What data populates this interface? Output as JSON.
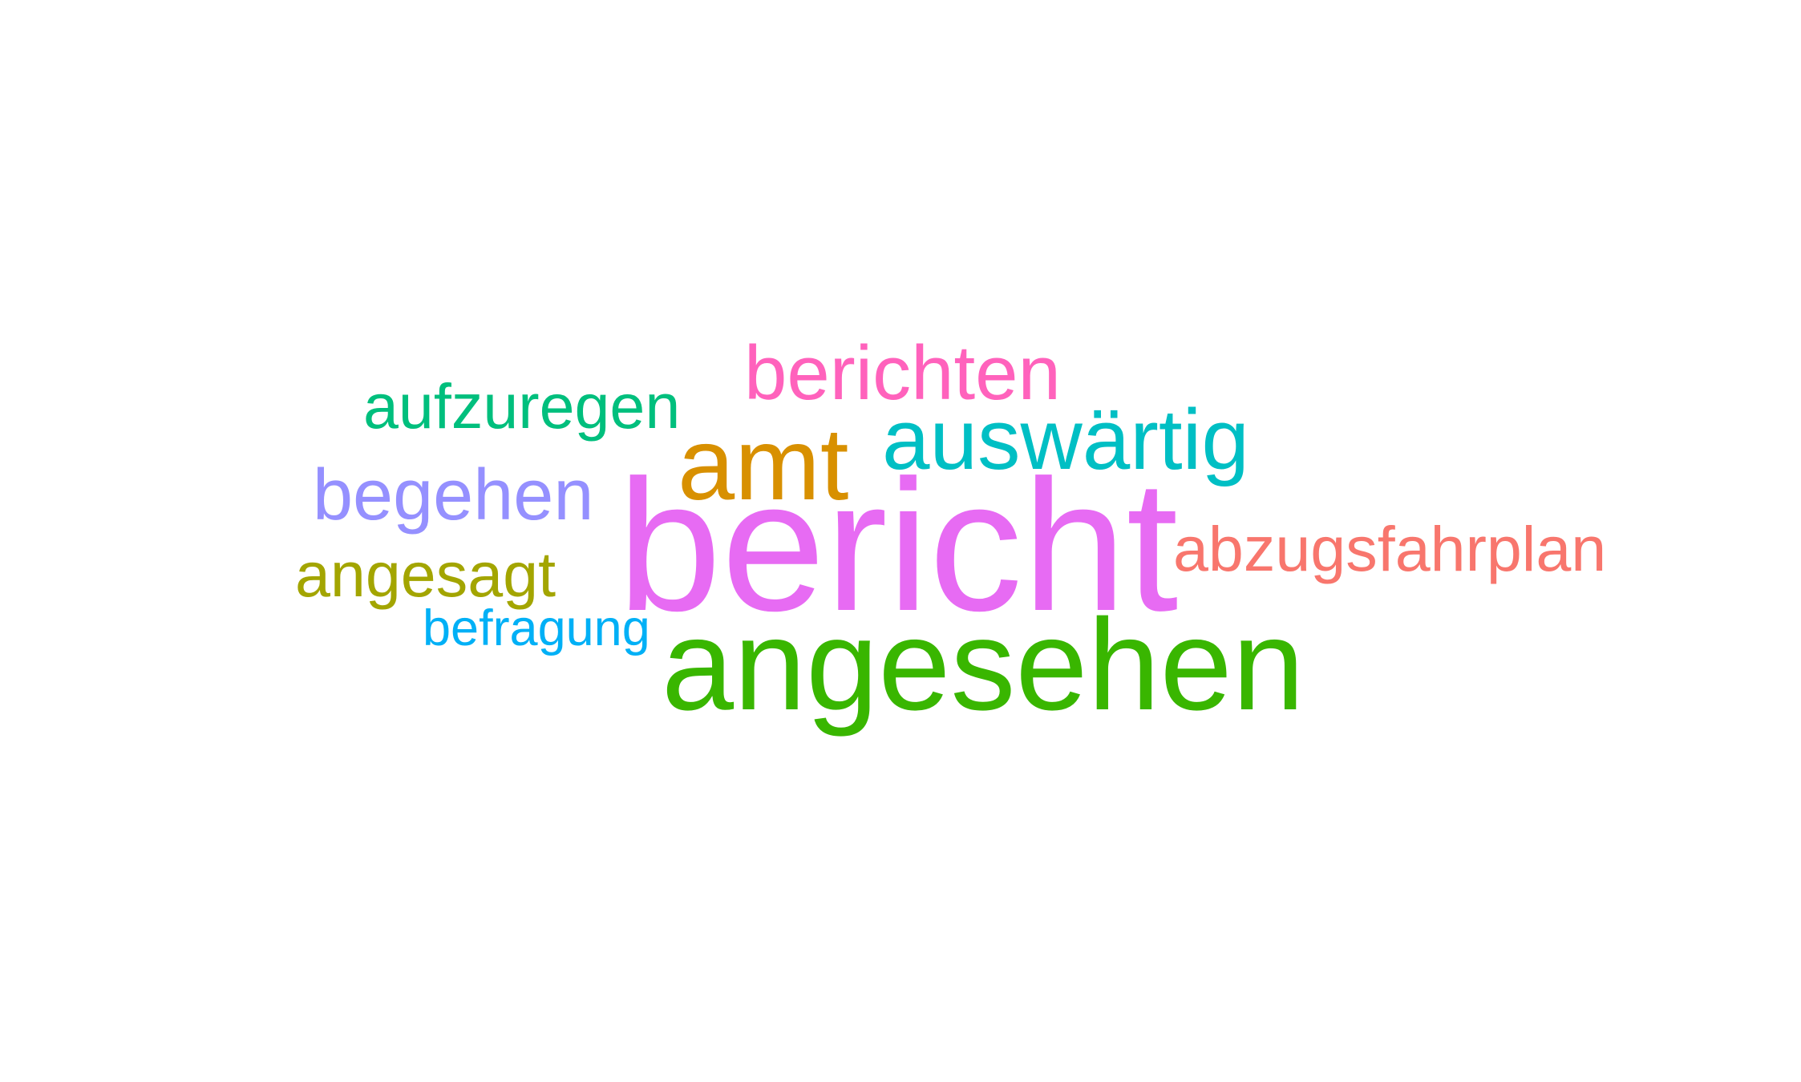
{
  "word_cloud": {
    "words": [
      {
        "text": "bericht",
        "color": "#E76BF3"
      },
      {
        "text": "angesehen",
        "color": "#39B600"
      },
      {
        "text": "amt",
        "color": "#D89000"
      },
      {
        "text": "auswärtig",
        "color": "#00BFC4"
      },
      {
        "text": "berichten",
        "color": "#FF62BC"
      },
      {
        "text": "begehen",
        "color": "#9590FF"
      },
      {
        "text": "abzugsfahrplan",
        "color": "#F8766D"
      },
      {
        "text": "aufzuregen",
        "color": "#00BF7D"
      },
      {
        "text": "angesagt",
        "color": "#A3A500"
      },
      {
        "text": "befragung",
        "color": "#00B0F6"
      }
    ]
  }
}
